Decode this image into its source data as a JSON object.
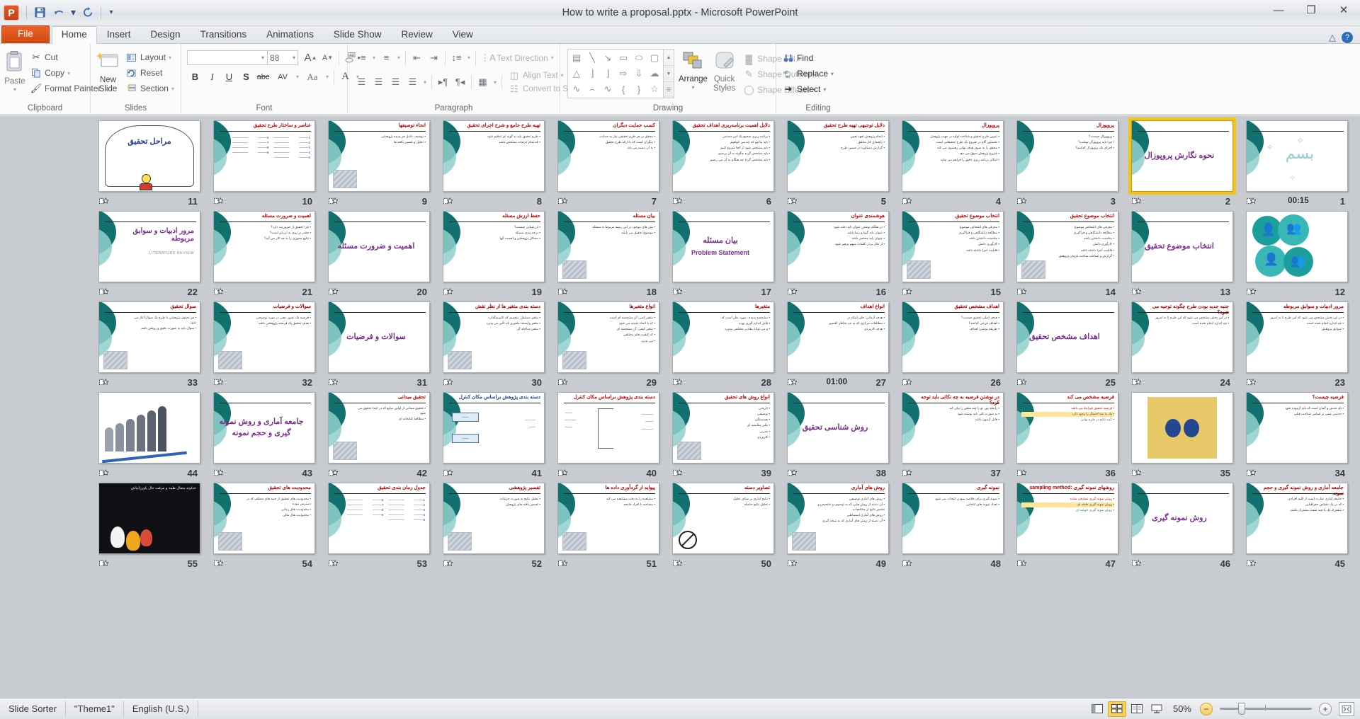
{
  "app": {
    "title": "How to write a proposal.pptx  -  Microsoft PowerPoint",
    "logo": "P"
  },
  "quick_access": {
    "save": "save-icon",
    "undo": "undo-icon",
    "undo_caret": "▾",
    "redo": "redo-icon",
    "customize": "▾"
  },
  "window_controls": {
    "minimize": "—",
    "restore": "❐",
    "close": "✕"
  },
  "tabs": [
    {
      "label": "File",
      "kind": "file"
    },
    {
      "label": "Home",
      "kind": "active"
    },
    {
      "label": "Insert",
      "kind": "normal"
    },
    {
      "label": "Design",
      "kind": "normal"
    },
    {
      "label": "Transitions",
      "kind": "normal"
    },
    {
      "label": "Animations",
      "kind": "normal"
    },
    {
      "label": "Slide Show",
      "kind": "normal"
    },
    {
      "label": "Review",
      "kind": "normal"
    },
    {
      "label": "View",
      "kind": "normal"
    }
  ],
  "ribbon": {
    "clipboard": {
      "label": "Clipboard",
      "paste": "Paste",
      "cut": "Cut",
      "copy": "Copy",
      "format_painter": "Format Painter"
    },
    "slides": {
      "label": "Slides",
      "new_slide": "New\nSlide",
      "new_slide_line1": "New",
      "new_slide_line2": "Slide",
      "layout": "Layout",
      "reset": "Reset",
      "section": "Section"
    },
    "font": {
      "label": "Font",
      "font_name": "",
      "font_size": "88",
      "grow": "A",
      "shrink": "A",
      "clear_format": "clear-formatting-icon",
      "bold": "B",
      "italic": "I",
      "underline": "U",
      "shadow": "S",
      "strikethrough": "abc",
      "char_spacing": "AV",
      "change_case": "Aa",
      "font_color": "A"
    },
    "paragraph": {
      "label": "Paragraph",
      "text_direction": "Text Direction",
      "align_text": "Align Text",
      "convert_smartart": "Convert to SmartArt"
    },
    "drawing": {
      "label": "Drawing",
      "arrange": "Arrange",
      "quick_styles_line1": "Quick",
      "quick_styles_line2": "Styles",
      "shape_fill": "Shape Fill",
      "shape_outline": "Shape Outline",
      "shape_effects": "Shape Effects",
      "shapes": [
        "▤",
        "╲",
        "↘",
        "▭",
        "⬭",
        "▢",
        "△",
        "└",
        "┗",
        "⇨",
        "⇩",
        "☁",
        "⌇",
        "⌒",
        "∿",
        "{",
        "}",
        "☆"
      ]
    },
    "editing": {
      "label": "Editing",
      "find": "Find",
      "replace": "Replace",
      "select": "Select"
    }
  },
  "status_bar": {
    "view": "Slide Sorter",
    "theme": "\"Theme1\"",
    "language": "English (U.S.)",
    "zoom": "50%",
    "view_buttons": [
      "normal-view-icon",
      "slide-sorter-view-icon",
      "reading-view-icon",
      "slideshow-view-icon"
    ],
    "zoom_out": "−",
    "zoom_in": "+",
    "fit_window": "fit-to-window-icon"
  },
  "slides": [
    {
      "n": 1,
      "timing": "00:15",
      "kind": "bismillah"
    },
    {
      "n": 2,
      "timing": "",
      "kind": "title",
      "title": "نحوه نگارش پروپوزال",
      "selected": true
    },
    {
      "n": 3,
      "timing": "",
      "kind": "bullets",
      "title": "پروپوزال",
      "lines": [
        "پروپوزال چیست؟",
        "چرا باید پروپوزال نوشت؟",
        "اجزای یک پروپوزال کدامند؟"
      ]
    },
    {
      "n": 4,
      "timing": "",
      "kind": "text",
      "title": "پروپوزال",
      "lines": [
        "تدوین طرح تحقیق و شناخت اولیه در جهت پژوهش",
        "نخستین گام در شروع یک طرح تحقیقاتی است",
        "محقق را به سوی هدف نهایی رهنمون می کند",
        "شروع پژوهش سوق می دهد",
        "امکان برنامه ریزی دقیق را فراهم می نماید"
      ]
    },
    {
      "n": 5,
      "timing": "",
      "kind": "text",
      "title": "دلایل توجیهی تهیه طرح تحقیق",
      "lines": [
        "انجام پژوهش تعهد تعیین",
        "راهنمای کار محقق",
        "گزارش دستاورد در ضمین طرح"
      ]
    },
    {
      "n": 6,
      "timing": "",
      "kind": "text",
      "title": "دلایل اهمیت برنامه‌ریزی اهداف تحقیق",
      "lines": [
        "برنامه ریزی صحیح یک امر مستمر",
        "باید بدانیم که چه می خواهیم",
        "باید مشخص شود از کجا شروع کنیم",
        "باید مشخص گردد چگونه به آن برسیم",
        "باید مشخص گردد چه هنگام به آن می رسیم"
      ]
    },
    {
      "n": 7,
      "timing": "",
      "kind": "text",
      "title": "کسب حمایت دیگران",
      "lines": [
        "محقق در هر طرح تحقیقی نیاز به حمایت",
        "دیگران است که با ارائه طرح تحقیق",
        "به آن دست می یابد"
      ]
    },
    {
      "n": 8,
      "timing": "",
      "kind": "text",
      "title": "تهیه طرح جامع و شرح اجرای تحقیق",
      "lines": [
        "طرح تحقیق باید به گونه ای تنظیم شود",
        "که تمام جزئیات مشخص باشد"
      ]
    },
    {
      "n": 9,
      "timing": "",
      "kind": "text-img",
      "title": "انحاء توصیفها",
      "lines": [
        "توصیف عامل هر پدیده پژوهشی",
        "تحلیل و تفسیر یافته ها"
      ]
    },
    {
      "n": 10,
      "timing": "",
      "kind": "toc",
      "title": "عناصر و ساختار طرح تحقیق"
    },
    {
      "n": 11,
      "timing": "",
      "kind": "cartoon",
      "title": "مراحل تحقیق"
    },
    {
      "n": 12,
      "timing": "",
      "kind": "circles"
    },
    {
      "n": 13,
      "timing": "",
      "kind": "title",
      "title": "انتخاب موضوع تحقیق"
    },
    {
      "n": 14,
      "timing": "",
      "kind": "text-img",
      "title": "انتخاب موضوع تحقیق",
      "lines": [
        "معرفی های اشخاص موضوع",
        "مطالعه دانشگاهی و فراگیری",
        "مناسبت دانشتن باشد",
        "کارآوری دانش",
        "قابلیت اجرا داشته باشد",
        "گزارش و شناخت ساخت بازمان پژوهش"
      ]
    },
    {
      "n": 15,
      "timing": "",
      "kind": "text-img",
      "title": "انتخاب موضوع تحقیق",
      "lines": [
        "معرفی های اشخاص موضوع",
        "مطالعه دانشگاهی و فراگیری",
        "مناسبت دانشتن باشد",
        "کارآوری دانش",
        "قابلیت اجرا داشته باشد"
      ]
    },
    {
      "n": 16,
      "timing": "",
      "kind": "text",
      "title": "هوشمندی عنوان",
      "lines": [
        "در هنگام نوشتن عنوان باید دقت شود",
        "عنوان باید گویا و رسا باشد",
        "عنوان باید مختصر باشد",
        "از بکار بردن کلمات مبهم پرهیز شود"
      ]
    },
    {
      "n": 17,
      "timing": "",
      "kind": "title2",
      "title": "بیان مسئله",
      "subtitle": "Problem Statement"
    },
    {
      "n": 18,
      "timing": "",
      "kind": "text-img",
      "title": "بیان مسئله",
      "lines": [
        "متن های موجود در این زمینه مربوط به مسئله",
        "موضوع تحقیق می باشد"
      ]
    },
    {
      "n": 19,
      "timing": "",
      "kind": "text",
      "title": "حفظ ارزش مسئله",
      "lines": [
        "ارزشیابی چیست؟",
        "درجه بندی مسئله",
        "مسائل پژوهشی و اهمیت آنها"
      ]
    },
    {
      "n": 20,
      "timing": "",
      "kind": "title",
      "title": "اهمیت و ضرورت مسئله"
    },
    {
      "n": 21,
      "timing": "",
      "kind": "text",
      "title": "اهمیت و ضرورت مسئله",
      "lines": [
        "چرا تحقیق از ضروریت دارد؟",
        "چقدر بر روی به ارزش است؟",
        "نتایج محوری را به چه کار می آید؟"
      ]
    },
    {
      "n": 22,
      "timing": "",
      "kind": "title-sub",
      "title": "مرور ادبیات و سوابق مربوطه",
      "subtitle": "LITERATURE REVIEW"
    },
    {
      "n": 23,
      "timing": "",
      "kind": "text",
      "title": "مرور ادبیات و سوابق مربوطه",
      "lines": [
        "در این بخش مشخص می شود که این طرح تا به امروز",
        "چه اندازه انجام شده است",
        "سوابق پژوهش"
      ]
    },
    {
      "n": 24,
      "timing": "",
      "kind": "text",
      "title": "جنبه جدید بودن طرح چگونه توجیه می شود؟",
      "lines": [
        "در این بخش مشخص می شود که این طرح تا به امروز",
        "چه اندازه انجام شده است"
      ]
    },
    {
      "n": 25,
      "timing": "",
      "kind": "title",
      "title": "اهداف مشخص تحقیق"
    },
    {
      "n": 26,
      "timing": "",
      "kind": "text",
      "title": "اهداف مشخص تحقیق",
      "lines": [
        "هدف اصلی تحقیق چیست؟",
        "اهداف فرعی کدامند؟",
        "طریقه نوشتن اهداف"
      ]
    },
    {
      "n": 27,
      "timing": "01:00",
      "kind": "text",
      "title": "انواع اهداف",
      "lines": [
        "هدف آرمانی: حلی اینکه در",
        "مطالعات مرکزی که به جد بخاطر کلسیم",
        "هدف کاربردی"
      ]
    },
    {
      "n": 28,
      "timing": "",
      "kind": "text",
      "title": "متغیرها",
      "lines": [
        "مشخصه پدیده ، مورد نظر است که",
        "قابل اندازه گیری بوده",
        "و می تواند مقادیر مختلفی بپذیرد"
      ]
    },
    {
      "n": 29,
      "timing": "",
      "kind": "text-img",
      "title": "انواع متغیرها",
      "lines": [
        "متغیر کمی: آن مشخصه ای است",
        "که با اعداد تحدید می شود",
        "متغیر کیفی: آن مشخصه ای",
        "که کیفیت های مختلفی",
        "می پذیرد"
      ]
    },
    {
      "n": 30,
      "timing": "",
      "kind": "text-img",
      "title": "دسته بندی متغیر ها از نظر نقش",
      "lines": [
        "متغیر مستقل: متغیری که تأثیرمیگذارد",
        "متغیر وابسته: متغیری که تأثیر می پذیرد",
        "متغیر مداخله گر"
      ]
    },
    {
      "n": 31,
      "timing": "",
      "kind": "title",
      "title": "سوالات و فرضیات"
    },
    {
      "n": 32,
      "timing": "",
      "kind": "text-img",
      "title": "سوالات و فرضیات",
      "lines": [
        "فرضیه یک تصور ذهنی در مورد توضیحی",
        "هدف تحقیق یک فرضیه پژوهشی باشد"
      ]
    },
    {
      "n": 33,
      "timing": "",
      "kind": "text-img",
      "title": "سوال تحقیق",
      "lines": [
        "هر تحقیق پژوهشی با طرح یک سوال آغاز می شود",
        "سوال باید به صورت دقیق و روشن باشد"
      ]
    },
    {
      "n": 34,
      "timing": "",
      "kind": "text",
      "title": "فرضیه چیست؟",
      "lines": [
        "یک حدس و گمان است که باید آزموده شود",
        "حدسی مبنی بر اساس شناخت قبلی"
      ]
    },
    {
      "n": 35,
      "timing": "",
      "kind": "photo-hands"
    },
    {
      "n": 36,
      "timing": "",
      "kind": "text-color",
      "title": "فرضیه مشخص می کند",
      "lines": [
        "فرضیه تحقیق شرایط می باشد",
        "یک به سه احتمال را وجود دارد",
        "تأیید نتایج در طرح نهایی"
      ]
    },
    {
      "n": 37,
      "timing": "",
      "kind": "text",
      "title": "در نوشتن فرضیه به چه نکاتی باید توجه کرد؟",
      "lines": [
        "رابطه بین دو یا چند متغیر را بیان کند",
        "به صورت کلی باید نوشته شود",
        "قابل آزمون باشد"
      ]
    },
    {
      "n": 38,
      "timing": "",
      "kind": "title",
      "title": "روش شناسی تحقیق"
    },
    {
      "n": 39,
      "timing": "",
      "kind": "text-img",
      "title": "انواع روش های تحقیق",
      "lines": [
        "تاریخی",
        "توصیفی",
        "همبستگی",
        "علی مقایسه ای",
        "تجربی",
        "کاربردی"
      ]
    },
    {
      "n": 40,
      "timing": "",
      "kind": "diagram-rb",
      "title": "دسته بندی پژوهش براساس مکان کنترل"
    },
    {
      "n": 41,
      "timing": "",
      "kind": "diagram-blue",
      "title": "دسته بندی پژوهش براساس مکان کنترل"
    },
    {
      "n": 42,
      "timing": "",
      "kind": "text-img",
      "title": "تحقیق میدانی",
      "lines": [
        "تحقیق میدانی از اولین منابع که در ابتدا تحقیق می شود",
        "مطالعه کتابخانه ای"
      ]
    },
    {
      "n": 43,
      "timing": "",
      "kind": "title",
      "title": "جامعه آماری و روش نمونه گیری و حجم نمونه"
    },
    {
      "n": 44,
      "timing": "",
      "kind": "photo-people"
    },
    {
      "n": 45,
      "timing": "",
      "kind": "text",
      "title": "جامعه آماری و روش نمونه گیری و حجم نمونه",
      "lines": [
        "جامعه آماری عبارت است از کلیه افرادی",
        "که در یک مقیاس جغرافیایی",
        "مشترک یک یا چند صفت مشترک باشند"
      ]
    },
    {
      "n": 46,
      "timing": "",
      "kind": "title",
      "title": "روش نمونه گیری"
    },
    {
      "n": 47,
      "timing": "",
      "kind": "text-color",
      "title": "روشهای نمونه گیری :sampling method",
      "lines": [
        "روش نمونه گیری تصادفی ساده",
        "روش نمونه گیری طبقه ای",
        "روش نمونه گیری خوشه ای"
      ]
    },
    {
      "n": 48,
      "timing": "",
      "kind": "text",
      "title": "نمونه گیری",
      "lines": [
        "نمونه گیری برای خلاصه نمودن انتخاب می شود",
        "تعداد نمونه های انتخابی"
      ]
    },
    {
      "n": 49,
      "timing": "",
      "kind": "text-img",
      "title": "روش های آماری",
      "lines": [
        "روش های آماری توصیفی",
        "آن دسته از روش هایی که به توصیف و تشخیص و تفسیر نتایج از مشاهدات",
        "روش های آماری استنباطی",
        "آن دسته از روش های آماری که به نتیجه گیری"
      ]
    },
    {
      "n": 50,
      "timing": "",
      "kind": "text-noimg",
      "title": "تصاویر دسته",
      "lines": [
        "نتایج آماری بر مبنای تحلیل",
        "تحلیل نتایج حاصله"
      ]
    },
    {
      "n": 51,
      "timing": "",
      "kind": "text-img",
      "title": "پیواید از گردآوری داده ها",
      "lines": [
        "مشاهده را به دقت مشاهده می کند",
        "مصاحبه با افراد جامعه"
      ]
    },
    {
      "n": 52,
      "timing": "",
      "kind": "text-img",
      "title": "تفسیر پژوهشی",
      "lines": [
        "تحلیل نتایج به صورت جزئیات",
        "تفسیر یافته های پژوهش"
      ]
    },
    {
      "n": 53,
      "timing": "",
      "kind": "toc2",
      "title": "جدول زمان بندی تحقیق"
    },
    {
      "n": 54,
      "timing": "",
      "kind": "text-img",
      "title": "محدودیت های تحقیق",
      "lines": [
        "محدودیت های تحقیق از جنبه های مختلف که در دسترس نبوده",
        "محدودیت های زمانی",
        "محدودیت های مالی"
      ]
    },
    {
      "n": 55,
      "timing": "",
      "kind": "photo-tulip",
      "title": "خداوند متعال طیبه و مرفت حال پاورزانیاش"
    }
  ]
}
